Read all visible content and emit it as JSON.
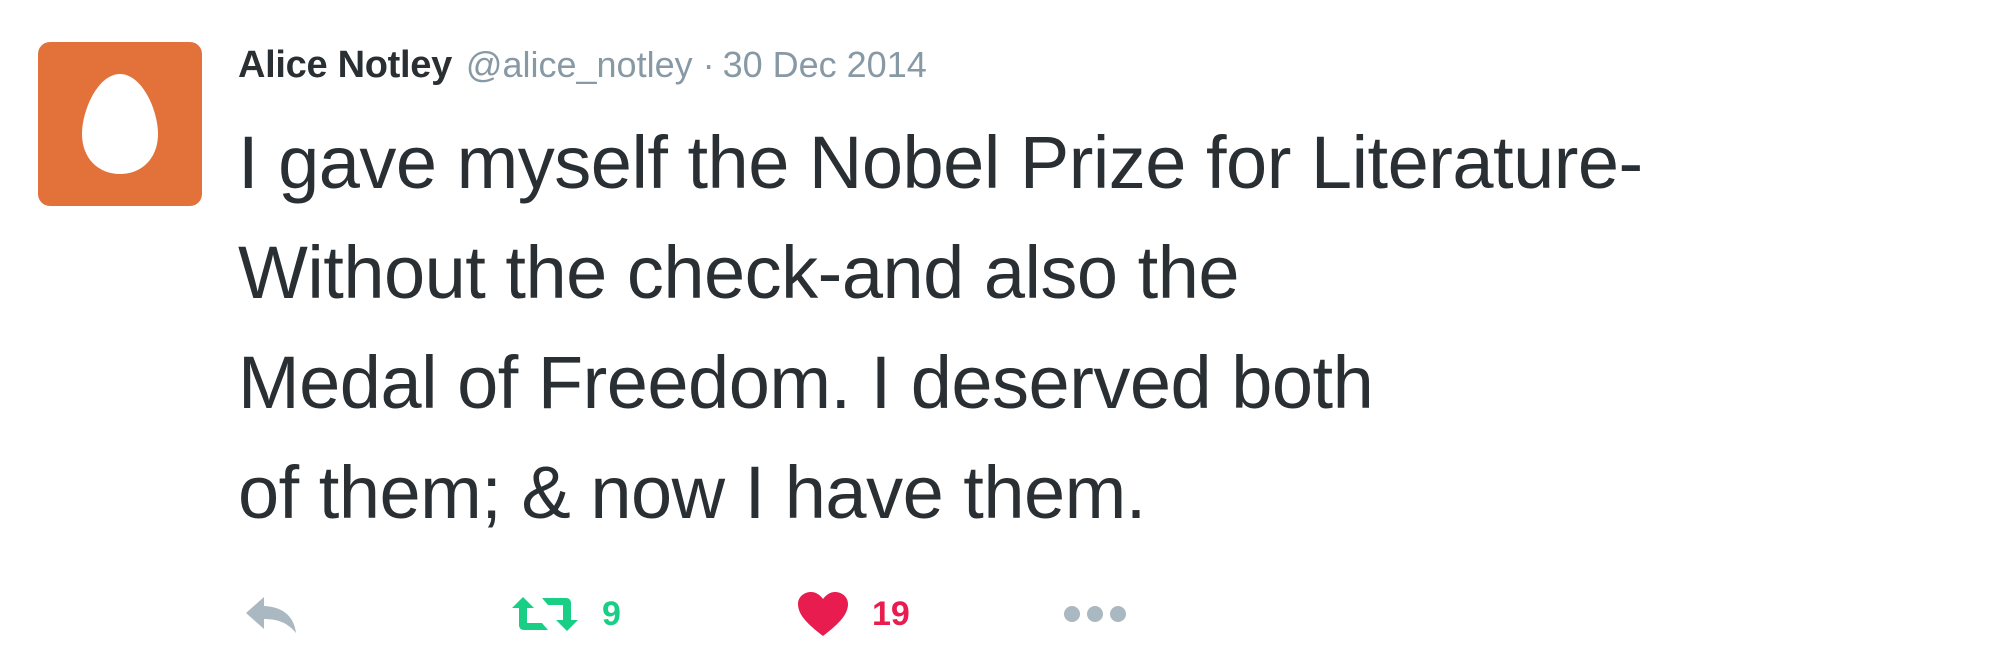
{
  "tweet": {
    "author": {
      "name": "Alice Notley",
      "handle": "@alice_notley",
      "avatar_icon": "egg-avatar-icon",
      "avatar_color": "#e2713a"
    },
    "separator": "·",
    "date": "30 Dec 2014",
    "text_lines": [
      "I gave myself the Nobel Prize for Literature-",
      "Without the check-and also the",
      "Medal of Freedom. I deserved both",
      "of them; & now I have them."
    ],
    "actions": {
      "reply": {
        "icon": "reply-icon"
      },
      "retweet": {
        "icon": "retweet-icon",
        "count": "9",
        "color": "#19cf86"
      },
      "like": {
        "icon": "heart-icon",
        "count": "19",
        "color": "#e81c4f"
      },
      "more": {
        "icon": "more-icon"
      }
    }
  }
}
